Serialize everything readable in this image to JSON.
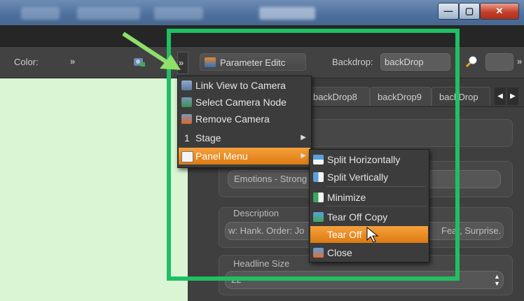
{
  "window": {
    "minimize_glyph": "—",
    "maximize_glyph": "▢",
    "close_glyph": "✕"
  },
  "toolbar": {
    "color_label": "Color:",
    "chevron_glyph": "»",
    "parameter_editor_label": "Parameter Editc",
    "backdrop_label": "Backdrop:",
    "backdrop_value": "backDrop",
    "search_icon": "magnifier-icon"
  },
  "tabs": [
    {
      "label": "backDrop8"
    },
    {
      "label": "backDrop9"
    },
    {
      "label": "backDrop"
    }
  ],
  "panel": {
    "field_emotions": "Emotions - Strong",
    "description_label": "Description",
    "description_value": "w: Hank. Order: Jo",
    "description_tail": "Fear, Surprise.",
    "headline_label": "Headline Size",
    "headline_value": "22"
  },
  "context_menu": {
    "items": [
      {
        "label": "Link View to Camera",
        "icon": "camera-link-icon"
      },
      {
        "label": "Select Camera Node",
        "icon": "camera-select-icon"
      },
      {
        "label": "Remove Camera",
        "icon": "camera-remove-icon"
      },
      {
        "label": "Stage",
        "prefix": "1",
        "has_submenu": true
      },
      {
        "label": "Panel Menu",
        "icon": "panel-icon",
        "has_submenu": true,
        "highlighted": true
      }
    ]
  },
  "submenu": {
    "items": [
      {
        "label": "Split Horizontally",
        "icon": "split-horizontal-icon"
      },
      {
        "label": "Split Vertically",
        "icon": "split-vertical-icon"
      },
      {
        "label": "Minimize",
        "icon": "minimize-icon"
      },
      {
        "label": "Tear Off Copy",
        "icon": "tear-off-copy-icon"
      },
      {
        "label": "Tear Off",
        "highlighted": true
      },
      {
        "label": "Close",
        "icon": "close-panel-icon"
      }
    ]
  },
  "colors": {
    "accent_orange": "#e8891f",
    "annotation_green": "#1fbf63",
    "left_pane": "#d9f5d3"
  }
}
